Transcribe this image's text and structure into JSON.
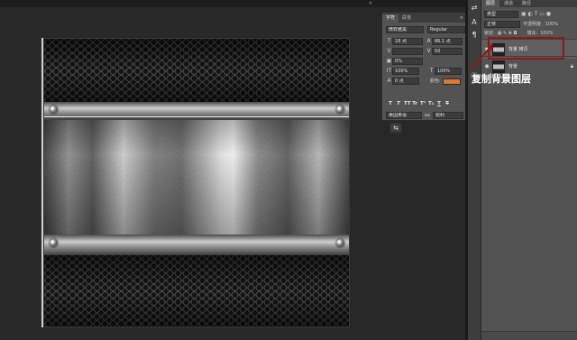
{
  "colors": {
    "workspace": "#282828",
    "panel": "#535353",
    "highlight_border": "#8b1a1a",
    "text_color_swatch": "#e0782a"
  },
  "character_panel": {
    "tabs": [
      "字符",
      "段落"
    ],
    "font_family": "微软雅黑",
    "font_style": "Regular",
    "font_size": "18 点",
    "leading": "86.1 点",
    "kerning": "",
    "tracking": "50",
    "tsume": "0%",
    "vertical_scale": "100%",
    "horizontal_scale": "100%",
    "baseline_shift": "0 点",
    "color_label": "颜色:",
    "format_buttons": [
      "T",
      "T",
      "TT",
      "Tr",
      "T¹",
      "T₁",
      "T",
      "T"
    ],
    "language": "美国英语",
    "antialias": "锐利"
  },
  "layers_panel": {
    "tabs": [
      "图层",
      "通道",
      "路径"
    ],
    "filter_kind": "类型",
    "blend_mode": "正常",
    "opacity_label": "不透明度:",
    "opacity_value": "100%",
    "lock_label": "锁定:",
    "fill_label": "填充:",
    "fill_value": "100%",
    "layers": [
      {
        "name": "背景 拷贝",
        "visible": true,
        "selected": true
      },
      {
        "name": "背景",
        "visible": true,
        "selected": false,
        "locked": true
      }
    ]
  },
  "annotation": {
    "text": "复制背景图层"
  },
  "icons": {
    "side_column": [
      "swap-arrows-icon",
      "text-tool-icon",
      "paragraph-icon",
      "info-icon"
    ]
  }
}
